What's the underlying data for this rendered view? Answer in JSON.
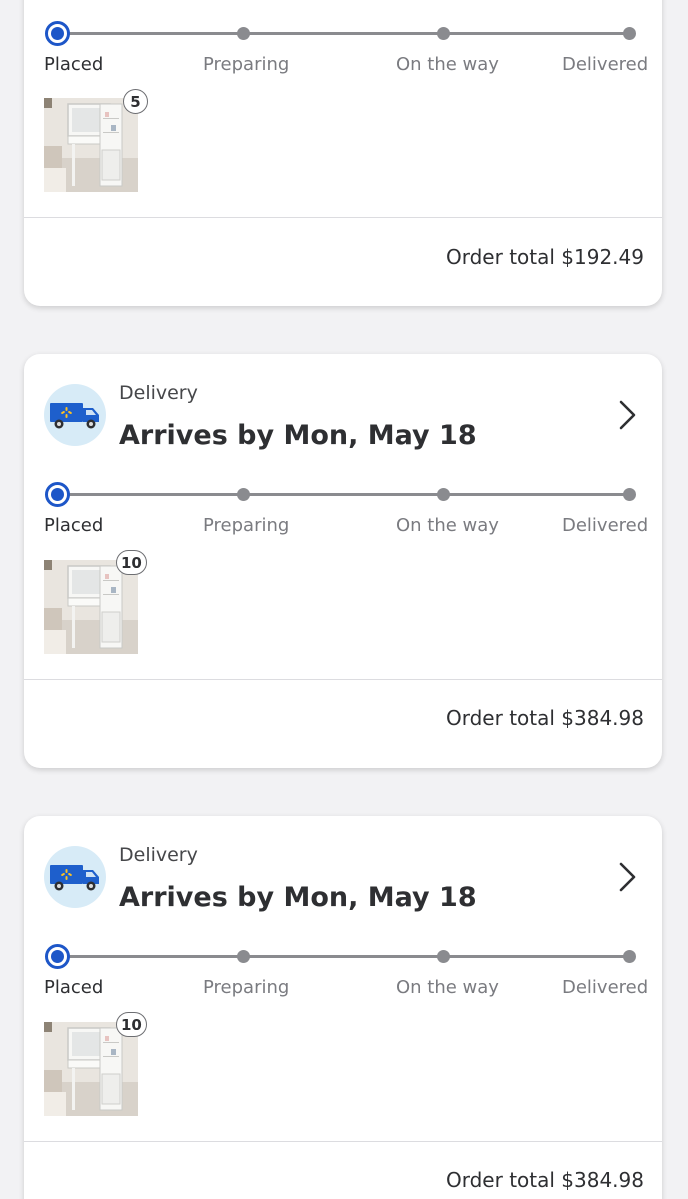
{
  "stages": [
    "Placed",
    "Preparing",
    "On the way",
    "Delivered"
  ],
  "orders": [
    {
      "badge": "5",
      "order_total": "Order total $192.49",
      "current_stage": 0
    },
    {
      "delivery_label": "Delivery",
      "arrives": "Arrives by Mon, May 18",
      "badge": "10",
      "order_total": "Order total $384.98",
      "current_stage": 0
    },
    {
      "delivery_label": "Delivery",
      "arrives": "Arrives by Mon, May 18",
      "badge": "10",
      "order_total": "Order total $384.98",
      "current_stage": 0
    }
  ],
  "icons": {
    "truck": "delivery-truck-icon",
    "chevron": "chevron-right-icon",
    "spark": "walmart-spark-icon"
  },
  "colors": {
    "accent": "#1d56c8",
    "truck_body": "#1e5fcc",
    "truck_circle": "#d7ebf7",
    "track_inactive": "#8a8b8f"
  }
}
